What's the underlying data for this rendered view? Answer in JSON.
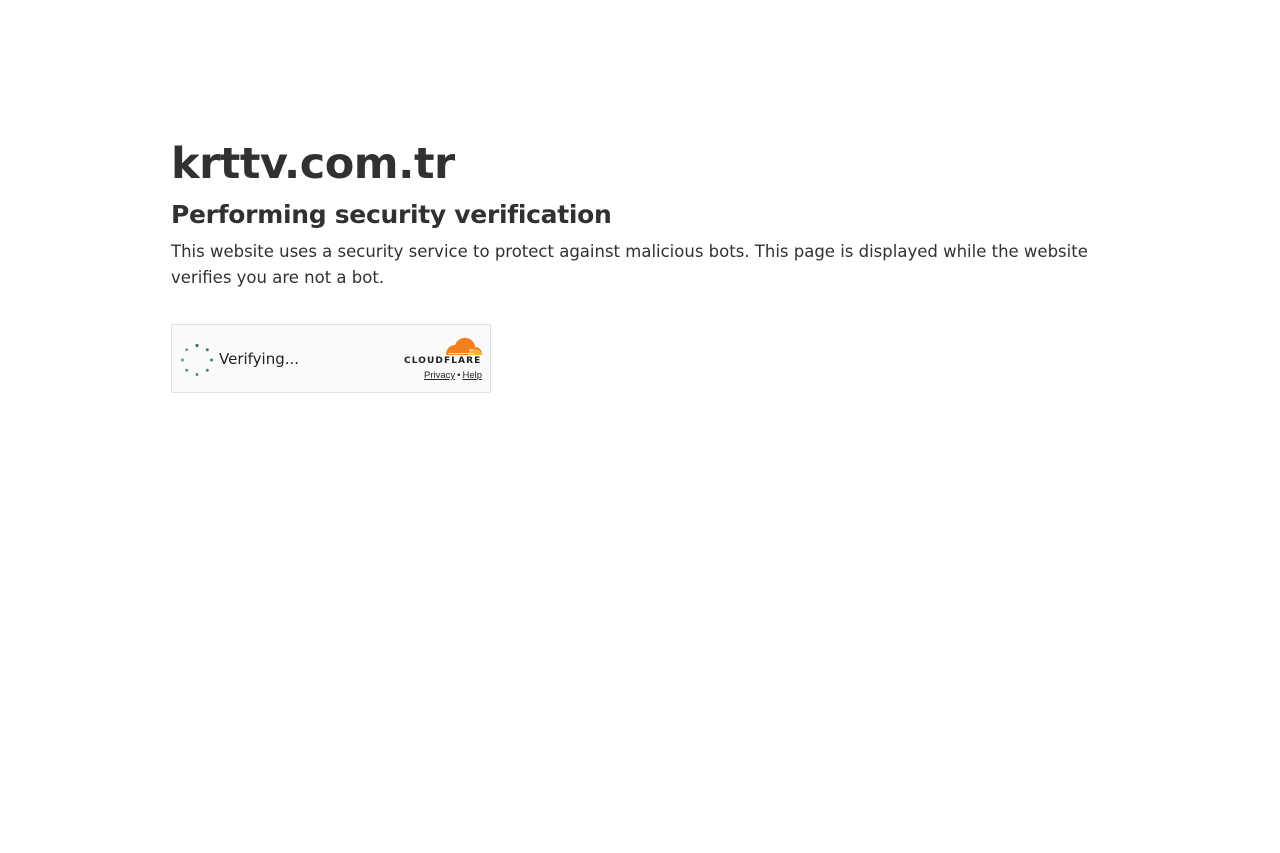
{
  "site": {
    "title": "krttv.com.tr"
  },
  "verification": {
    "heading": "Performing security verification",
    "description": "This website uses a security service to protect against malicious bots. This page is displayed while the website verifies you are not a bot."
  },
  "widget": {
    "status_text": "Verifying...",
    "brand_text": "CLOUDFLARE",
    "links": {
      "privacy": "Privacy",
      "separator": "•",
      "help": "Help"
    },
    "icons": {
      "spinner": "loading-spinner-icon",
      "logo": "cloudflare-cloud-icon"
    },
    "colors": {
      "spinner": "#2c7a4b",
      "cloud_orange": "#f38020",
      "cloud_light": "#faae40",
      "background": "#fafafa",
      "border": "#e0e0e0"
    }
  }
}
